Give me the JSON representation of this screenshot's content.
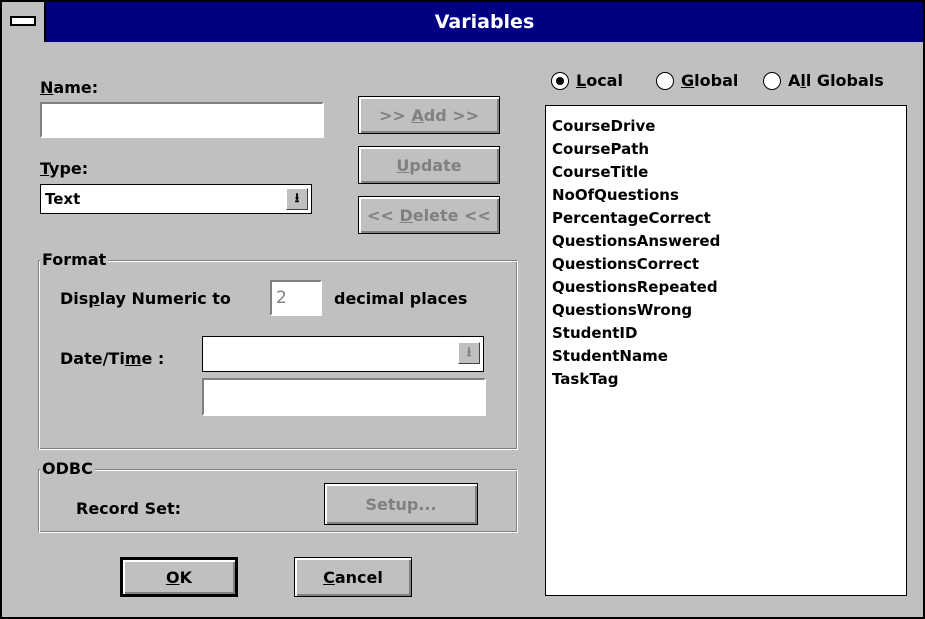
{
  "window": {
    "title": "Variables"
  },
  "name": {
    "label_pre": "",
    "label_ul": "N",
    "label_post": "ame:",
    "value": ""
  },
  "type": {
    "label_pre": "",
    "label_ul": "T",
    "label_post": "ype:",
    "value": "Text",
    "arrow": "⭳"
  },
  "buttons": {
    "add": {
      "pre": ">> ",
      "ul": "A",
      "post": "dd >>"
    },
    "update": {
      "pre": "",
      "ul": "U",
      "post": "pdate"
    },
    "delete": {
      "pre": "<< ",
      "ul": "D",
      "post": "elete <<"
    },
    "setup": {
      "label": "Setup..."
    },
    "ok": {
      "pre": "",
      "ul": "O",
      "post": "K"
    },
    "cancel": {
      "pre": "",
      "ul": "C",
      "post": "ancel"
    }
  },
  "format": {
    "group_label": "Format",
    "display_pre": "Dis",
    "display_ul": "p",
    "display_post": "lay Numeric to",
    "decimals_value": "2",
    "decimals_suffix": "decimal places",
    "datetime_pre": "Date/Ti",
    "datetime_ul": "m",
    "datetime_post": "e :",
    "datetime_value": "",
    "datetime_format": ""
  },
  "odbc": {
    "group_label": "ODBC",
    "record_set_label": "Record Set:"
  },
  "scope": {
    "local": {
      "pre": "",
      "ul": "L",
      "post": "ocal",
      "selected": true
    },
    "global": {
      "pre": "",
      "ul": "G",
      "post": "lobal",
      "selected": false
    },
    "all": {
      "pre": "A",
      "ul": "l",
      "post": "l Globals",
      "selected": false
    }
  },
  "variables": [
    "CourseDrive",
    "CoursePath",
    "CourseTitle",
    "NoOfQuestions",
    "PercentageCorrect",
    "QuestionsAnswered",
    "QuestionsCorrect",
    "QuestionsRepeated",
    "QuestionsWrong",
    "StudentID",
    "StudentName",
    "TaskTag"
  ],
  "colors": {
    "titlebar": "#000080",
    "face": "#c0c0c0",
    "disabled_text": "#808080"
  }
}
